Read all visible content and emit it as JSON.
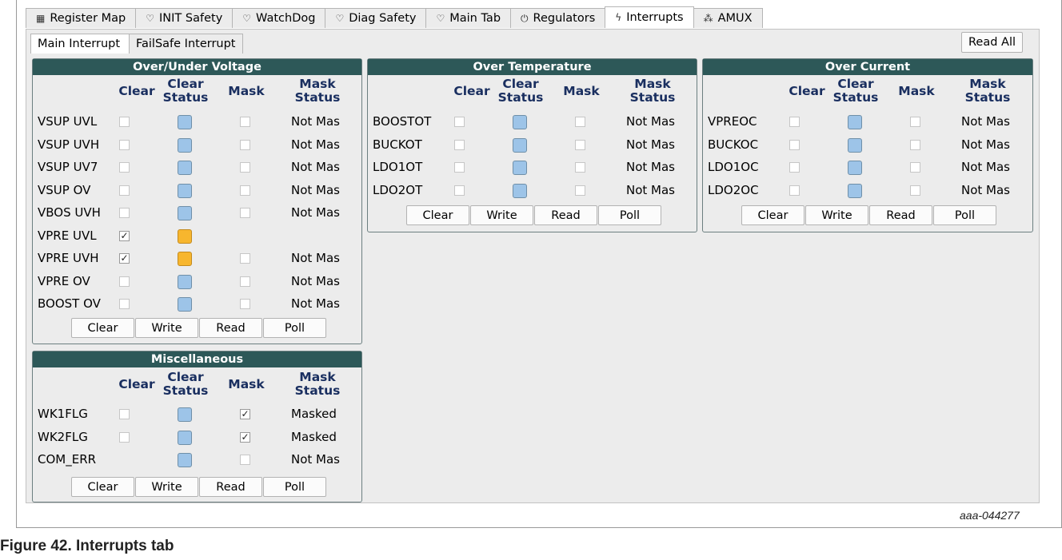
{
  "tabs": [
    {
      "icon": "register-map-icon",
      "glyph": "▦",
      "label": "Register Map"
    },
    {
      "icon": "shield-icon",
      "glyph": "♡",
      "label": "INIT Safety"
    },
    {
      "icon": "shield-icon",
      "glyph": "♡",
      "label": "WatchDog"
    },
    {
      "icon": "shield-icon",
      "glyph": "♡",
      "label": "Diag Safety"
    },
    {
      "icon": "shield-icon",
      "glyph": "♡",
      "label": "Main Tab"
    },
    {
      "icon": "power-icon",
      "glyph": "⏻",
      "label": "Regulators"
    },
    {
      "icon": "lightning-icon",
      "glyph": "ϟ",
      "label": "Interrupts"
    },
    {
      "icon": "chart-icon",
      "glyph": "⁂",
      "label": "AMUX"
    }
  ],
  "active_tab": "Interrupts",
  "sub_tabs": [
    "Main Interrupt",
    "FailSafe Interrupt"
  ],
  "read_all": "Read All",
  "headers": {
    "clear": "Clear",
    "clear_status_1": "Clear",
    "clear_status_2": "Status",
    "mask": "Mask",
    "mask_status_1": "Mask",
    "mask_status_2": "Status"
  },
  "buttons": {
    "clear": "Clear",
    "write": "Write",
    "read": "Read",
    "poll": "Poll"
  },
  "groups": {
    "voltage": {
      "title": "Over/Under Voltage",
      "rows": [
        {
          "label": "VSUP UVL",
          "clear": false,
          "status": "blue",
          "mask": false,
          "mask_status": "Not Mas"
        },
        {
          "label": "VSUP UVH",
          "clear": false,
          "status": "blue",
          "mask": false,
          "mask_status": "Not Mas"
        },
        {
          "label": "VSUP UV7",
          "clear": false,
          "status": "blue",
          "mask": false,
          "mask_status": "Not Mas"
        },
        {
          "label": "VSUP OV",
          "clear": false,
          "status": "blue",
          "mask": false,
          "mask_status": "Not Mas"
        },
        {
          "label": "VBOS UVH",
          "clear": false,
          "status": "blue",
          "mask": false,
          "mask_status": "Not Mas"
        },
        {
          "label": "VPRE UVL",
          "clear": true,
          "status": "orange",
          "mask": null,
          "mask_status": ""
        },
        {
          "label": "VPRE UVH",
          "clear": true,
          "status": "orange",
          "mask": false,
          "mask_status": "Not Mas"
        },
        {
          "label": "VPRE OV",
          "clear": false,
          "status": "blue",
          "mask": false,
          "mask_status": "Not Mas"
        },
        {
          "label": "BOOST OV",
          "clear": false,
          "status": "blue",
          "mask": false,
          "mask_status": "Not Mas"
        }
      ]
    },
    "temperature": {
      "title": "Over Temperature",
      "rows": [
        {
          "label": "BOOSTOT",
          "clear": false,
          "status": "blue",
          "mask": false,
          "mask_status": "Not Mas"
        },
        {
          "label": "BUCKOT",
          "clear": false,
          "status": "blue",
          "mask": false,
          "mask_status": "Not Mas"
        },
        {
          "label": "LDO1OT",
          "clear": false,
          "status": "blue",
          "mask": false,
          "mask_status": "Not Mas"
        },
        {
          "label": "LDO2OT",
          "clear": false,
          "status": "blue",
          "mask": false,
          "mask_status": "Not Mas"
        }
      ]
    },
    "current": {
      "title": "Over Current",
      "rows": [
        {
          "label": "VPREOC",
          "clear": false,
          "status": "blue",
          "mask": false,
          "mask_status": "Not Mas"
        },
        {
          "label": "BUCKOC",
          "clear": false,
          "status": "blue",
          "mask": false,
          "mask_status": "Not Mas"
        },
        {
          "label": "LDO1OC",
          "clear": false,
          "status": "blue",
          "mask": false,
          "mask_status": "Not Mas"
        },
        {
          "label": "LDO2OC",
          "clear": false,
          "status": "blue",
          "mask": false,
          "mask_status": "Not Mas"
        }
      ]
    },
    "misc": {
      "title": "Miscellaneous",
      "rows": [
        {
          "label": "WK1FLG",
          "clear": false,
          "status": "blue",
          "mask": true,
          "mask_status": "Masked"
        },
        {
          "label": "WK2FLG",
          "clear": false,
          "status": "blue",
          "mask": true,
          "mask_status": "Masked"
        },
        {
          "label": "COM_ERR",
          "clear": null,
          "status": "blue",
          "mask": false,
          "mask_status": "Not Mas"
        }
      ]
    }
  },
  "figure_id": "aaa-044277",
  "caption": "Figure 42. Interrupts tab",
  "colors": {
    "title_bar": "#2d5858",
    "status_blue": "#9dc4e8",
    "status_orange": "#f7b62e",
    "header_text": "#1a2f60"
  }
}
